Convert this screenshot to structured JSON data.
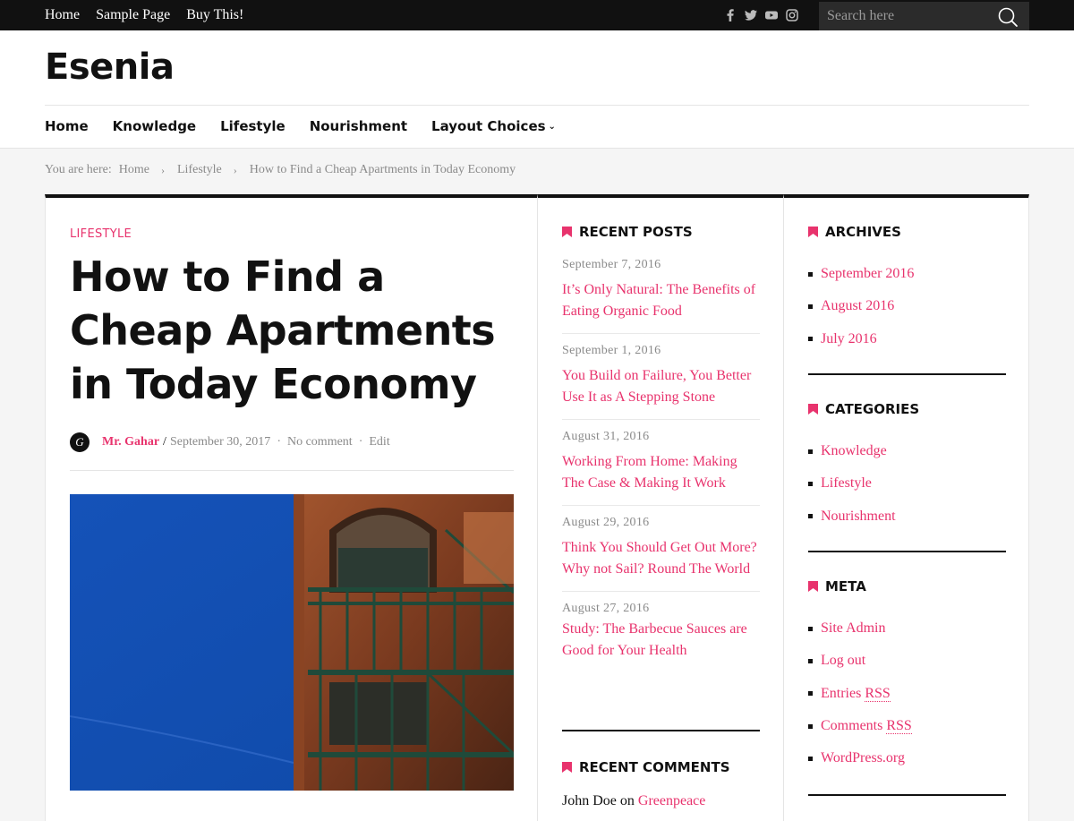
{
  "topbar": {
    "links": [
      "Home",
      "Sample Page",
      "Buy This!"
    ],
    "social_icons": [
      "facebook-icon",
      "twitter-icon",
      "youtube-icon",
      "instagram-icon"
    ],
    "search_placeholder": "Search here"
  },
  "header": {
    "site_title": "Esenia",
    "nav": [
      "Home",
      "Knowledge",
      "Lifestyle",
      "Nourishment",
      "Layout Choices"
    ]
  },
  "breadcrumb": {
    "prefix": "You are here:",
    "items": [
      "Home",
      "Lifestyle",
      "How to Find a Cheap Apartments in Today Economy"
    ]
  },
  "post": {
    "category": "LIFESTYLE",
    "title": "How to Find a Cheap Apartments in Today Economy",
    "avatar_letter": "G",
    "author": "Mr. Gahar",
    "date": "September 30, 2017",
    "comments": "No comment",
    "edit": "Edit"
  },
  "recent_posts": {
    "title": "RECENT POSTS",
    "items": [
      {
        "date": "September 7, 2016",
        "title": "It’s Only Natural: The Benefits of Eating Organic Food"
      },
      {
        "date": "September 1, 2016",
        "title": "You Build on Failure, You Better Use It as A Stepping Stone"
      },
      {
        "date": "August 31, 2016",
        "title": "Working From Home: Making The Case & Making It Work"
      },
      {
        "date": "August 29, 2016",
        "title": "Think You Should Get Out More? Why not Sail? Round The World"
      },
      {
        "date": "August 27, 2016",
        "title": "Study: The Barbecue Sauces are Good for Your Health"
      }
    ]
  },
  "recent_comments": {
    "title": "RECENT COMMENTS",
    "first_author": "John Doe",
    "first_on": "on",
    "first_post": "Greenpeace"
  },
  "archives": {
    "title": "ARCHIVES",
    "items": [
      "September 2016",
      "August 2016",
      "July 2016"
    ]
  },
  "categories": {
    "title": "CATEGORIES",
    "items": [
      "Knowledge",
      "Lifestyle",
      "Nourishment"
    ]
  },
  "meta": {
    "title": "META",
    "site_admin": "Site Admin",
    "logout": "Log out",
    "entries": "Entries",
    "comments": "Comments",
    "rss": "RSS",
    "wordpress": "WordPress.org"
  },
  "colors": {
    "accent": "#e8336d",
    "topbar": "#111111",
    "text": "#111111",
    "muted": "#8a8a8a"
  }
}
